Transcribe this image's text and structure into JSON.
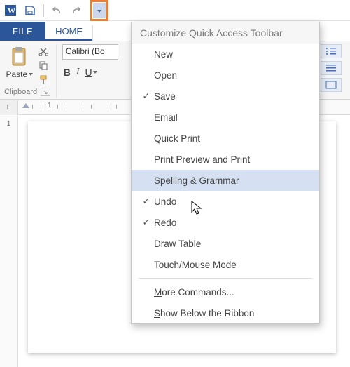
{
  "qat": {
    "items": [
      "word-app-icon",
      "save-icon",
      "undo-icon",
      "redo-icon"
    ],
    "dropdown_highlighted": true
  },
  "tabs": {
    "file": "FILE",
    "home": "HOME"
  },
  "ribbon": {
    "paste_label": "Paste",
    "font_name": "Calibri (Bo",
    "style_bold": "B",
    "style_italic": "I",
    "style_underline": "U",
    "clipboard_group": "Clipboard"
  },
  "ruler": {
    "corner": "L",
    "h_label_1": "1",
    "v_labels": [
      "1"
    ]
  },
  "menu": {
    "header": "Customize Quick Access Toolbar",
    "items": [
      {
        "label": "New",
        "checked": false
      },
      {
        "label": "Open",
        "checked": false
      },
      {
        "label": "Save",
        "checked": true
      },
      {
        "label": "Email",
        "checked": false
      },
      {
        "label": "Quick Print",
        "checked": false
      },
      {
        "label": "Print Preview and Print",
        "checked": false
      },
      {
        "label": "Spelling & Grammar",
        "checked": false,
        "hover": true
      },
      {
        "label": "Undo",
        "checked": true
      },
      {
        "label": "Redo",
        "checked": true
      },
      {
        "label": "Draw Table",
        "checked": false
      },
      {
        "label": "Touch/Mouse Mode",
        "checked": false
      }
    ],
    "more_commands": "More Commands...",
    "show_below": "Show Below the Ribbon"
  }
}
